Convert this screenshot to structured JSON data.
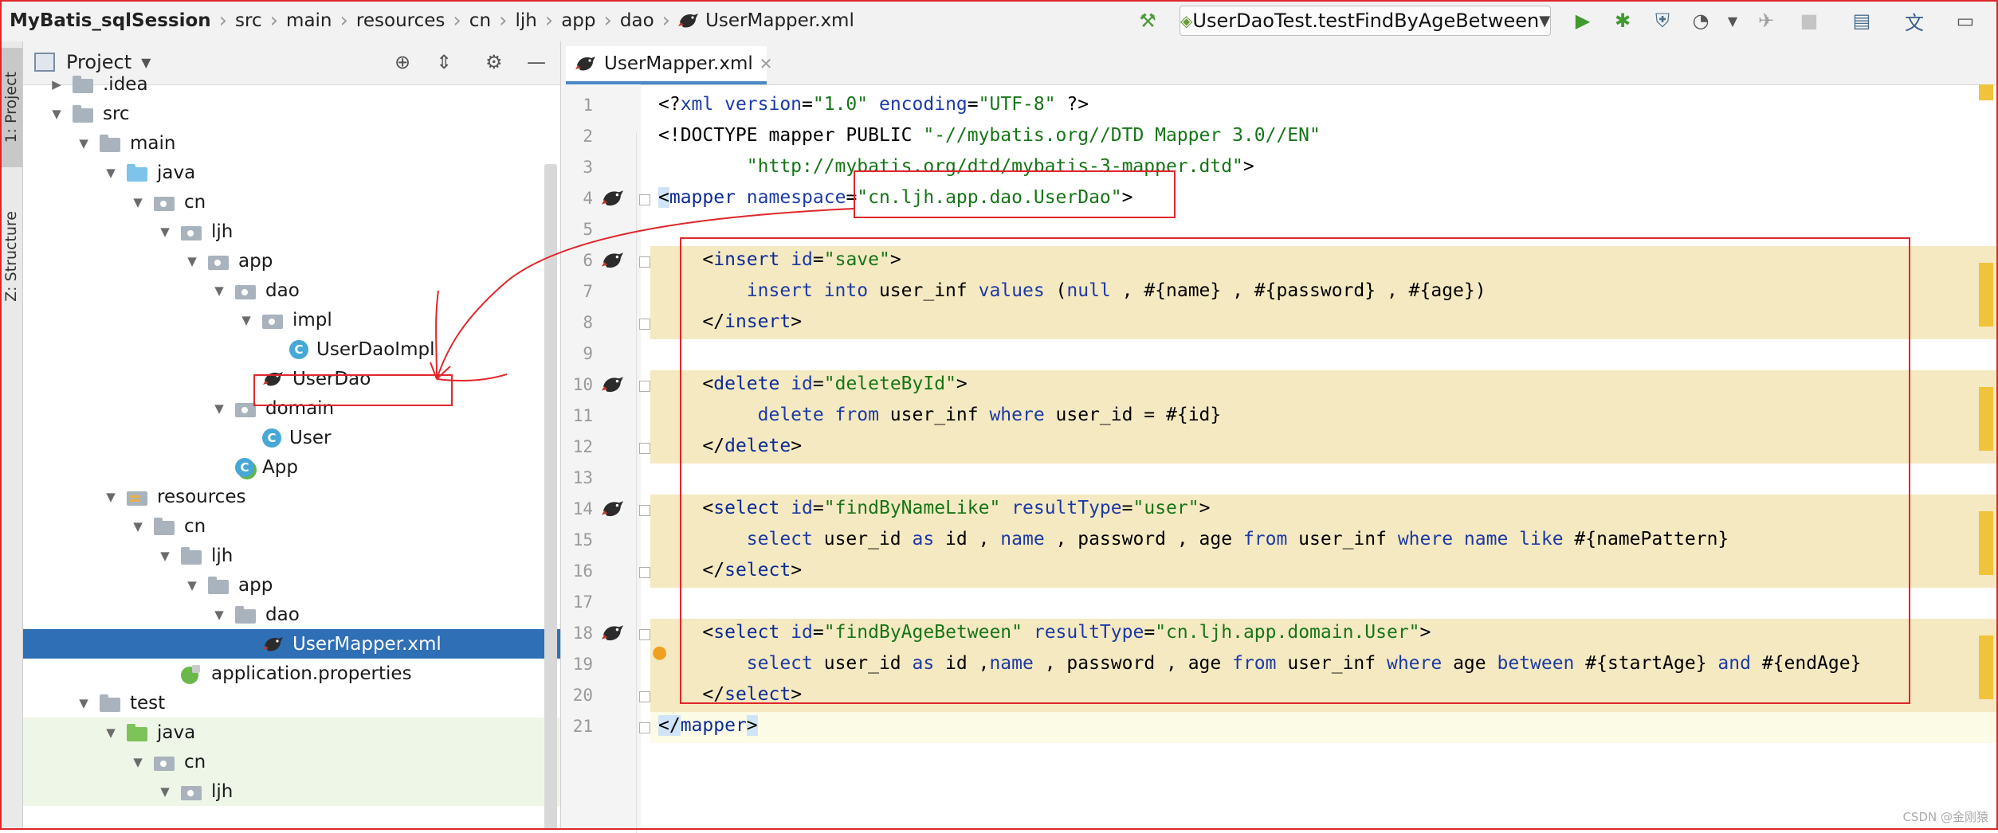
{
  "navbar": {
    "breadcrumbs": [
      "MyBatis_sqlSession",
      "src",
      "main",
      "resources",
      "cn",
      "ljh",
      "app",
      "dao",
      "UserMapper.xml"
    ],
    "run_config": "UserDaoTest.testFindByAgeBetween"
  },
  "strips": {
    "project_tab": "1: Project",
    "structure_tab": "Z: Structure"
  },
  "project_panel": {
    "title": "Project",
    "tree": [
      {
        "label": ".idea",
        "icon": "folder-icon"
      },
      {
        "label": "src",
        "icon": "folder-icon"
      },
      {
        "label": "main",
        "icon": "folder-icon"
      },
      {
        "label": "java",
        "icon": "source-folder-icon"
      },
      {
        "label": "cn",
        "icon": "package-icon"
      },
      {
        "label": "ljh",
        "icon": "package-icon"
      },
      {
        "label": "app",
        "icon": "package-icon"
      },
      {
        "label": "dao",
        "icon": "package-icon"
      },
      {
        "label": "impl",
        "icon": "package-icon"
      },
      {
        "label": "UserDaoImpl",
        "icon": "class-icon"
      },
      {
        "label": "UserDao",
        "icon": "mybatis-icon"
      },
      {
        "label": "domain",
        "icon": "package-icon"
      },
      {
        "label": "User",
        "icon": "class-icon"
      },
      {
        "label": "App",
        "icon": "app-class-icon"
      },
      {
        "label": "resources",
        "icon": "resources-folder-icon"
      },
      {
        "label": "cn",
        "icon": "folder-icon"
      },
      {
        "label": "ljh",
        "icon": "folder-icon"
      },
      {
        "label": "app",
        "icon": "folder-icon"
      },
      {
        "label": "dao",
        "icon": "folder-icon"
      },
      {
        "label": "UserMapper.xml",
        "icon": "mybatis-icon"
      },
      {
        "label": "application.properties",
        "icon": "properties-icon"
      },
      {
        "label": "test",
        "icon": "folder-icon"
      },
      {
        "label": "java",
        "icon": "test-folder-icon"
      },
      {
        "label": "cn",
        "icon": "package-icon"
      },
      {
        "label": "ljh",
        "icon": "package-icon"
      }
    ]
  },
  "editor": {
    "tab_label": "UserMapper.xml",
    "line_numbers": [
      "1",
      "2",
      "3",
      "4",
      "5",
      "6",
      "7",
      "8",
      "9",
      "10",
      "11",
      "12",
      "13",
      "14",
      "15",
      "16",
      "17",
      "18",
      "19",
      "20",
      "21"
    ],
    "code": {
      "l1": [
        "<?",
        "xml version",
        "=",
        "\"1.0\"",
        " encoding",
        "=",
        "\"UTF-8\"",
        " ?>"
      ],
      "l2": [
        "<!DOCTYPE mapper PUBLIC ",
        "\"-//mybatis.org//DTD Mapper 3.0//EN\""
      ],
      "l3": [
        "        ",
        "\"http://mybatis.org/dtd/mybatis-3-mapper.dtd\"",
        ">"
      ],
      "l4": [
        "<",
        "mapper",
        " namespace",
        "=",
        "\"cn.ljh.app.dao.UserDao\"",
        ">"
      ],
      "l6": [
        "    <",
        "insert",
        " id",
        "=",
        "\"save\"",
        ">"
      ],
      "l7": [
        "        ",
        "insert into",
        " user_inf ",
        "values",
        " (",
        "null",
        " , #{name} , #{password} , #{age})"
      ],
      "l8": [
        "    </",
        "insert",
        ">"
      ],
      "l10": [
        "    <",
        "delete",
        " id",
        "=",
        "\"deleteById\"",
        ">"
      ],
      "l11": [
        "         ",
        "delete from",
        " user_inf ",
        "where",
        " user_id = #{id}"
      ],
      "l12": [
        "    </",
        "delete",
        ">"
      ],
      "l14": [
        "    <",
        "select",
        " id",
        "=",
        "\"findByNameLike\"",
        " resultType",
        "=",
        "\"user\"",
        ">"
      ],
      "l15": [
        "        ",
        "select",
        " user_id ",
        "as",
        " id , ",
        "name",
        " , password , age ",
        "from",
        " user_inf ",
        "where",
        " ",
        "name",
        " ",
        "like",
        " #{namePattern}"
      ],
      "l16": [
        "    </",
        "select",
        ">"
      ],
      "l18": [
        "    <",
        "select",
        " id",
        "=",
        "\"findByAgeBetween\"",
        " resultType",
        "=",
        "\"cn.ljh.app.domain.User\"",
        ">"
      ],
      "l19": [
        "        ",
        "select",
        " user_id ",
        "as",
        " id ,",
        "name",
        " , password , age ",
        "from",
        " user_inf ",
        "where",
        " age ",
        "between",
        " #{startAge} ",
        "and",
        " #{endAge}"
      ],
      "l20": [
        "    </",
        "select",
        ">"
      ],
      "l21": [
        "</",
        "mapper",
        ">"
      ]
    }
  },
  "colors": {
    "selection": "#2f6fb5",
    "annotation_red": "#e0262b",
    "highlight": "#f5e9c1",
    "keyword": "#1c3aa6",
    "string": "#167517"
  },
  "watermark": "CSDN @金刚猿"
}
